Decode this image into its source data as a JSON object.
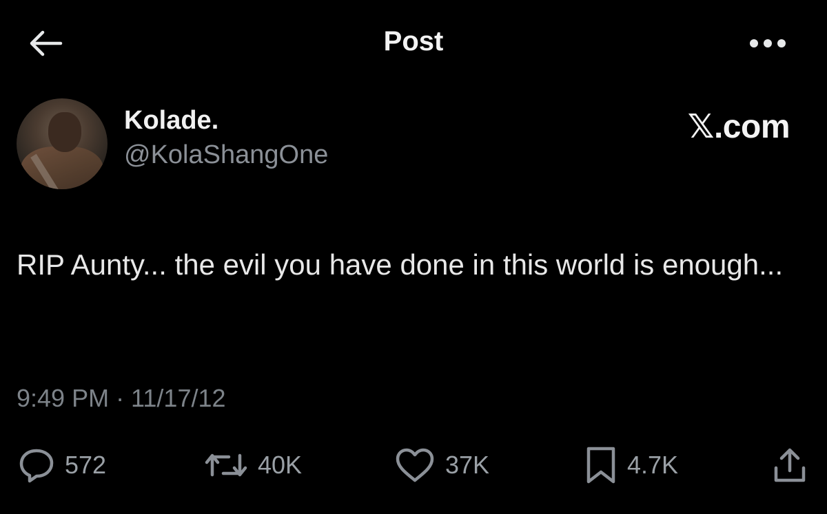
{
  "header": {
    "title": "Post",
    "back_icon": "arrow-left-icon",
    "more_icon": "more-horizontal-icon"
  },
  "author": {
    "display_name": "Kolade.",
    "handle": "@KolaShangOne",
    "avatar": "profile-photo"
  },
  "watermark": "𝕏.com",
  "post": {
    "text": "RIP Aunty... the evil you have done in this world is enough...",
    "timestamp": "9:49 PM · 11/17/12"
  },
  "actions": {
    "replies": "572",
    "reposts": "40K",
    "likes": "37K",
    "bookmarks": "4.7K"
  },
  "colors": {
    "background": "#000000",
    "primary_text": "#e7e9ea",
    "secondary_text": "#8b9097"
  }
}
